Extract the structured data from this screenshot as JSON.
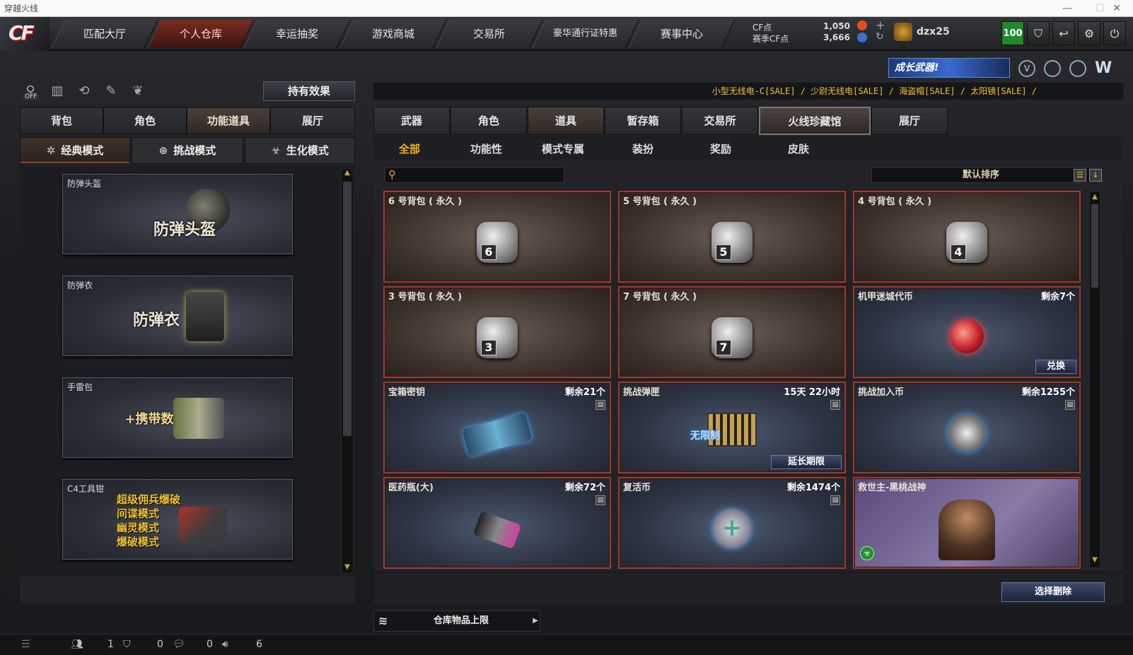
{
  "window": {
    "title": "穿越火线",
    "controls": [
      "—",
      "☐",
      "✕"
    ]
  },
  "nav": {
    "tabs": [
      {
        "label": "匹配大厅"
      },
      {
        "label": "个人仓库"
      },
      {
        "label": "幸运抽奖"
      },
      {
        "label": "游戏商城"
      },
      {
        "label": "交易所"
      },
      {
        "label": "豪华通行证特惠"
      },
      {
        "label": "赛事中心"
      }
    ],
    "cf_label": "CF点",
    "cf_value": "1,050",
    "season_label": "赛季CF点",
    "season_value": "3,666",
    "username": "dzx25",
    "level": "100"
  },
  "promo": {
    "banner": "成长武器!"
  },
  "left": {
    "effects_button": "持有效果",
    "off_label": "OFF",
    "tabs": [
      "背包",
      "角色",
      "功能道具",
      "展厅"
    ],
    "modes": [
      "经典模式",
      "挑战模式",
      "生化模式"
    ],
    "cards": [
      {
        "title": "防弹头盔",
        "big": "防弹头盔"
      },
      {
        "title": "防弹衣",
        "big": "防弹衣"
      },
      {
        "title": "手雷包",
        "big": "+携带数"
      },
      {
        "title": "C4工具钳",
        "lines": [
          "超级佣兵爆破",
          "间谍模式",
          "幽灵模式",
          "爆破模式"
        ]
      }
    ]
  },
  "ticker": "小型无线电-C[SALE] / 少尉无线电[SALE] / 海盗帽[SALE] / 太阳镜[SALE] /",
  "right": {
    "tabs": [
      "武器",
      "角色",
      "道具",
      "暂存箱",
      "交易所",
      "火线珍藏馆",
      "展厅"
    ],
    "subtabs": [
      "全部",
      "功能性",
      "模式专属",
      "装扮",
      "奖励",
      "皮肤"
    ],
    "sort_label": "默认排序",
    "items": [
      {
        "title": "6 号背包 ( 永久 )",
        "bag": "6"
      },
      {
        "title": "5 号背包 ( 永久 )",
        "bag": "5"
      },
      {
        "title": "4 号背包 ( 永久 )",
        "bag": "4"
      },
      {
        "title": "3 号背包 ( 永久 )",
        "bag": "3"
      },
      {
        "title": "7 号背包 ( 永久 )",
        "bag": "7"
      },
      {
        "title": "机甲迷城代币",
        "right": "剩余7个",
        "button": "兑换"
      },
      {
        "title": "宝箱密钥",
        "right": "剩余21个"
      },
      {
        "title": "挑战弹匣",
        "right": "15天 22小时",
        "button": "延长期限",
        "overlay": "无限制"
      },
      {
        "title": "挑战加入币",
        "right": "剩余1255个"
      },
      {
        "title": "医药瓶(大)",
        "right": "剩余72个"
      },
      {
        "title": "复活币",
        "right": "剩余1474个"
      },
      {
        "title": "救世主-黑桃战神"
      }
    ],
    "delete_button": "选择删除",
    "capacity_label": "仓库物品上限"
  },
  "status": {
    "v1": "1",
    "v2": "0",
    "v3": "0",
    "v4": "6"
  }
}
